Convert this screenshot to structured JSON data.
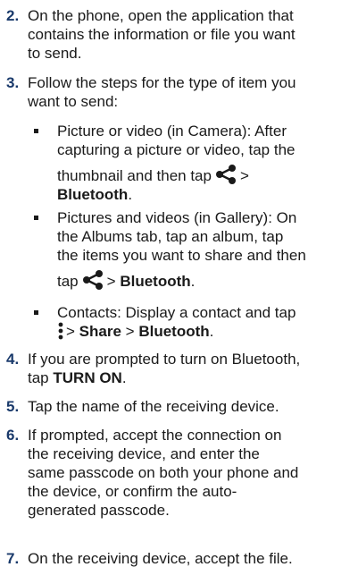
{
  "steps": [
    {
      "num": "2.",
      "lines": [
        "On the phone, open the application that",
        "contains the information or file you want",
        "to send."
      ]
    },
    {
      "num": "3.",
      "lines": [
        "Follow the steps for the type of item you",
        "want to send:"
      ],
      "bullets": [
        {
          "lines": [
            "Picture or video (in Camera): After",
            "capturing a picture or video, tap the"
          ],
          "tail_text": "thumbnail and then tap",
          "tail_sep": ">",
          "tail_bold": "Bluetooth",
          "tail_end": ".",
          "tail_icon": "share-icon"
        },
        {
          "lines": [
            "Pictures and videos (in Gallery): On",
            "the Albums tab, tap an album, tap",
            "the items you want to share and then"
          ],
          "tail_text": "tap",
          "tail_sep": ">",
          "tail_bold": "Bluetooth",
          "tail_end": ".",
          "tail_icon": "share-icon"
        },
        {
          "lines": [
            "Contacts: Display a contact and tap"
          ],
          "tail_sep": ">",
          "tail_bold1": "Share",
          "tail_sep2": ">",
          "tail_bold": "Bluetooth",
          "tail_end": ".",
          "tail_icon": "menu-more-icon"
        }
      ]
    },
    {
      "num": "4.",
      "lines": [
        "If you are prompted to turn on Bluetooth,"
      ],
      "line2_text": "tap",
      "line2_bold": "TURN ON",
      "line2_end": "."
    },
    {
      "num": "5.",
      "lines": [
        "Tap the name of the receiving device."
      ]
    },
    {
      "num": "6.",
      "lines": [
        "If prompted, accept the connection on",
        "the receiving device, and enter the",
        "same passcode on both your phone and",
        "the device, or confirm the auto-",
        "generated passcode."
      ]
    },
    {
      "num": "7.",
      "lines": [
        "On the receiving device, accept the file."
      ]
    }
  ]
}
